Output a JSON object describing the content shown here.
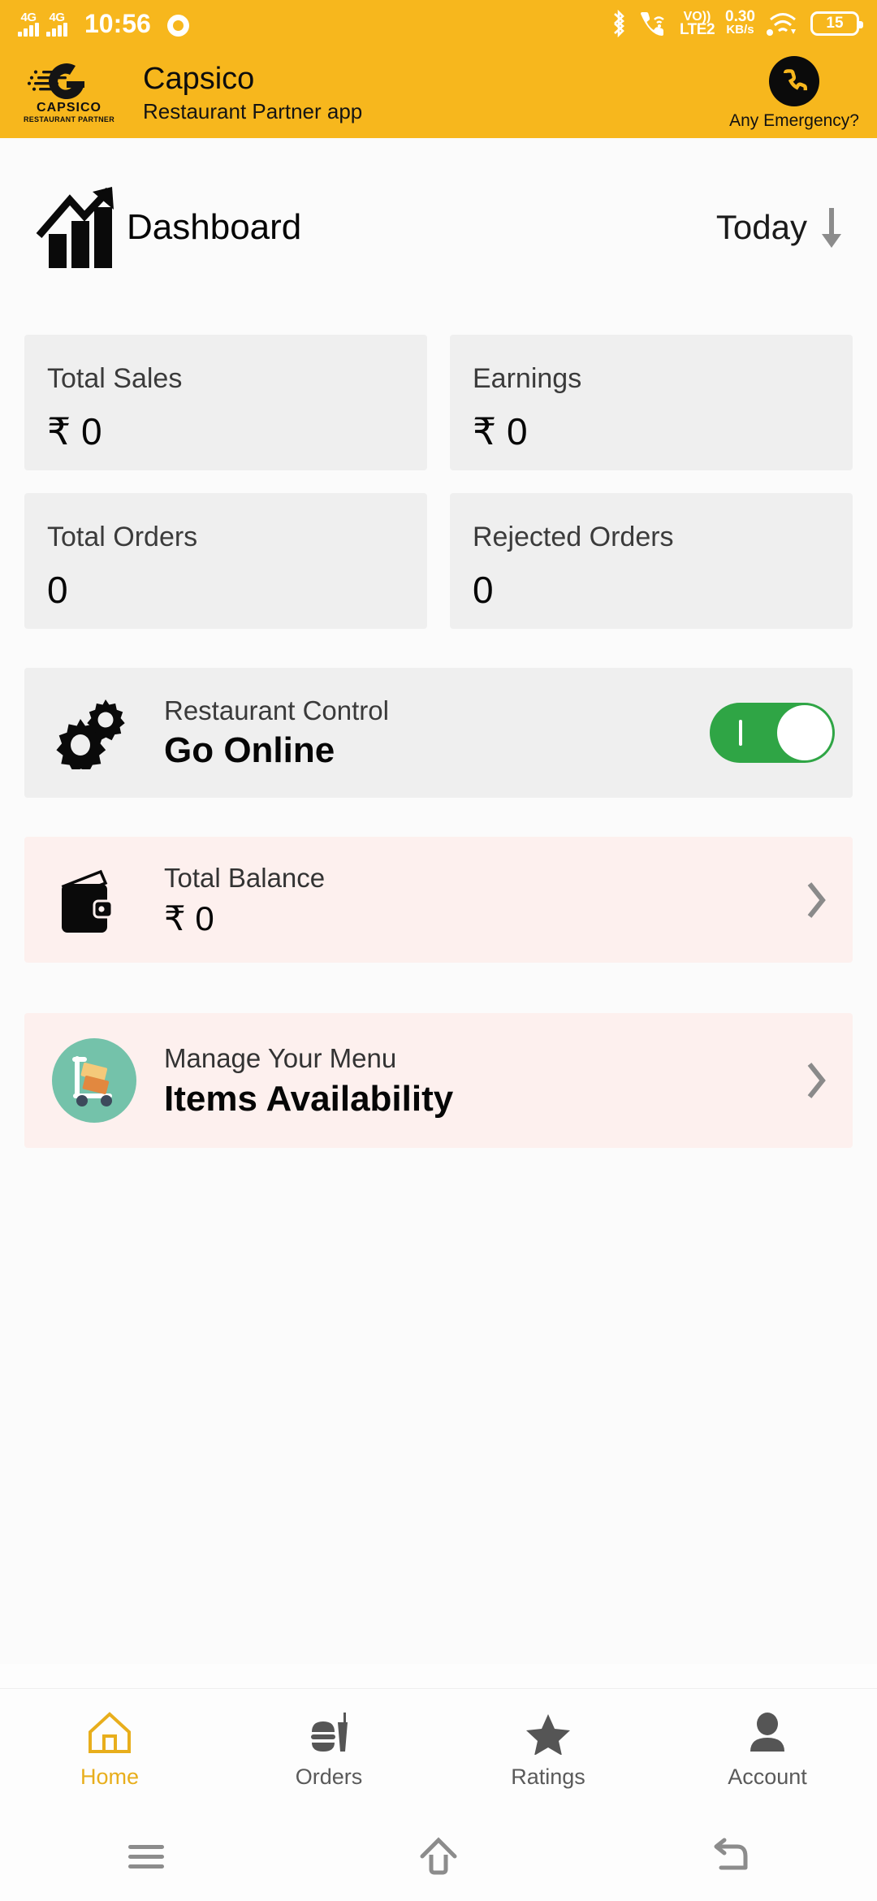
{
  "status_bar": {
    "sim1_network": "4G",
    "sim2_network": "4G",
    "time": "10:56",
    "chrome_icon": "chrome-icon",
    "bluetooth_icon": "bluetooth-icon",
    "call_wifi_icon": "wifi-calling-icon",
    "volte_line1": "VO))",
    "volte_line2": "LTE2",
    "net_speed_value": "0.30",
    "net_speed_unit": "KB/s",
    "wifi_icon": "wifi-icon",
    "hotspot_icon": "hotspot-icon",
    "battery_level": "15"
  },
  "app_bar": {
    "logo_word": "CAPSICO",
    "logo_sub": "RESTAURANT PARTNER",
    "title": "Capsico",
    "subtitle": "Restaurant Partner app",
    "emergency_label": "Any Emergency?",
    "emergency_icon": "phone-icon",
    "brand_color": "#F7B71D"
  },
  "dashboard": {
    "icon": "growth-chart-icon",
    "title": "Dashboard",
    "period_label": "Today",
    "period_arrow_icon": "arrow-down-icon"
  },
  "stats": [
    {
      "label": "Total Sales",
      "value": "₹ 0"
    },
    {
      "label": "Earnings",
      "value": "₹ 0"
    },
    {
      "label": "Total Orders",
      "value": "0"
    },
    {
      "label": "Rejected Orders",
      "value": "0"
    }
  ],
  "restaurant_control": {
    "icon": "gears-icon",
    "subtitle": "Restaurant Control",
    "title": "Go Online",
    "toggle_state": "on",
    "toggle_color": "#2FA545"
  },
  "balance_row": {
    "icon": "wallet-icon",
    "subtitle": "Total Balance",
    "value": "₹ 0",
    "chevron_icon": "chevron-right-icon",
    "bg_color": "#FDF0EE"
  },
  "menu_row": {
    "icon": "delivery-trolley-icon",
    "subtitle": "Manage Your Menu",
    "title": "Items Availability",
    "chevron_icon": "chevron-right-icon",
    "bg_color": "#FDF0EE",
    "avatar_color": "#74C2AA"
  },
  "tabs": [
    {
      "label": "Home",
      "icon": "home-icon",
      "active": true
    },
    {
      "label": "Orders",
      "icon": "fastfood-icon",
      "active": false
    },
    {
      "label": "Ratings",
      "icon": "star-icon",
      "active": false
    },
    {
      "label": "Account",
      "icon": "person-icon",
      "active": false
    }
  ],
  "android_nav": {
    "recents_icon": "menu-lines-icon",
    "home_icon": "home-outline-icon",
    "back_icon": "back-arrow-icon"
  }
}
